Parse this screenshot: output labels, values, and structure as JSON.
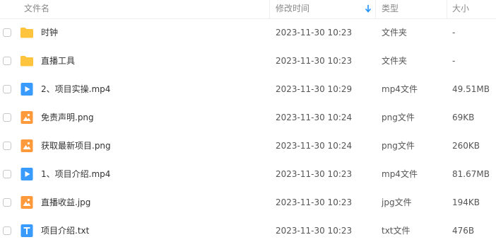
{
  "header": {
    "name_label": "文件名",
    "time_label": "修改时间",
    "type_label": "类型",
    "size_label": "大小",
    "sort_icon": "arrow-down-icon",
    "sort_color": "#1e90ff"
  },
  "colors": {
    "folder": "#ffc43d",
    "video": "#3a9bff",
    "image": "#ff9a3c",
    "text": "#3a9bff"
  },
  "files": [
    {
      "name": "时钟",
      "time": "2023-11-30 10:23",
      "type": "文件夹",
      "size": "-",
      "icon": "folder-icon"
    },
    {
      "name": "直播工具",
      "time": "2023-11-30 10:23",
      "type": "文件夹",
      "size": "-",
      "icon": "folder-icon"
    },
    {
      "name": "2、项目实操.mp4",
      "time": "2023-11-30 10:29",
      "type": "mp4文件",
      "size": "49.51MB",
      "icon": "video-icon"
    },
    {
      "name": "免责声明.png",
      "time": "2023-11-30 10:24",
      "type": "png文件",
      "size": "69KB",
      "icon": "image-icon"
    },
    {
      "name": "获取最新项目.png",
      "time": "2023-11-30 10:24",
      "type": "png文件",
      "size": "260KB",
      "icon": "image-icon"
    },
    {
      "name": "1、项目介绍.mp4",
      "time": "2023-11-30 10:23",
      "type": "mp4文件",
      "size": "81.67MB",
      "icon": "video-icon"
    },
    {
      "name": "直播收益.jpg",
      "time": "2023-11-30 10:23",
      "type": "jpg文件",
      "size": "194KB",
      "icon": "image-icon"
    },
    {
      "name": "项目介绍.txt",
      "time": "2023-11-30 10:23",
      "type": "txt文件",
      "size": "476B",
      "icon": "text-file-icon"
    }
  ]
}
